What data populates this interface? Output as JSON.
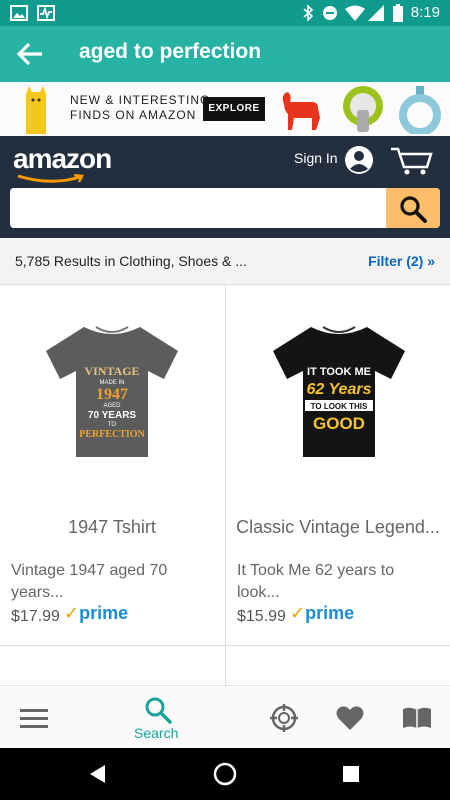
{
  "status_bar": {
    "time": "8:19"
  },
  "app_bar": {
    "title": "aged to perfection"
  },
  "ad_banner": {
    "line1": "NEW & INTERESTING",
    "line2": "FINDS ON AMAZON",
    "explore_label": "EXPLORE"
  },
  "amazon_header": {
    "logo": "amazon",
    "sign_in": "Sign In",
    "search_value": ""
  },
  "results": {
    "count_text": "5,785 Results in Clothing, Shoes & ...",
    "filter_text": "Filter (2) »"
  },
  "products": [
    {
      "shirt_lines": [
        "VINTAGE",
        "MADE IN",
        "1947",
        "AGED",
        "70 YEARS",
        "TO",
        "PERFECTION"
      ],
      "title": "1947 Tshirt",
      "description": "Vintage 1947 aged 70 years...",
      "price": "$17.99",
      "prime": "prime"
    },
    {
      "shirt_lines": [
        "IT TOOK ME",
        "62 Years",
        "TO LOOK THIS",
        "GOOD"
      ],
      "title": "Classic Vintage Legend...",
      "description": "It Took Me 62 years to look...",
      "price": "$15.99",
      "prime": "prime"
    }
  ],
  "bottom_nav": {
    "search_label": "Search"
  },
  "colors": {
    "teal_dark": "#0f9b8e",
    "teal": "#26b3a4",
    "amazon_navy": "#232f3e",
    "search_orange": "#febd69",
    "prime_blue": "#1a8cd8",
    "link_blue": "#0a66c2"
  }
}
